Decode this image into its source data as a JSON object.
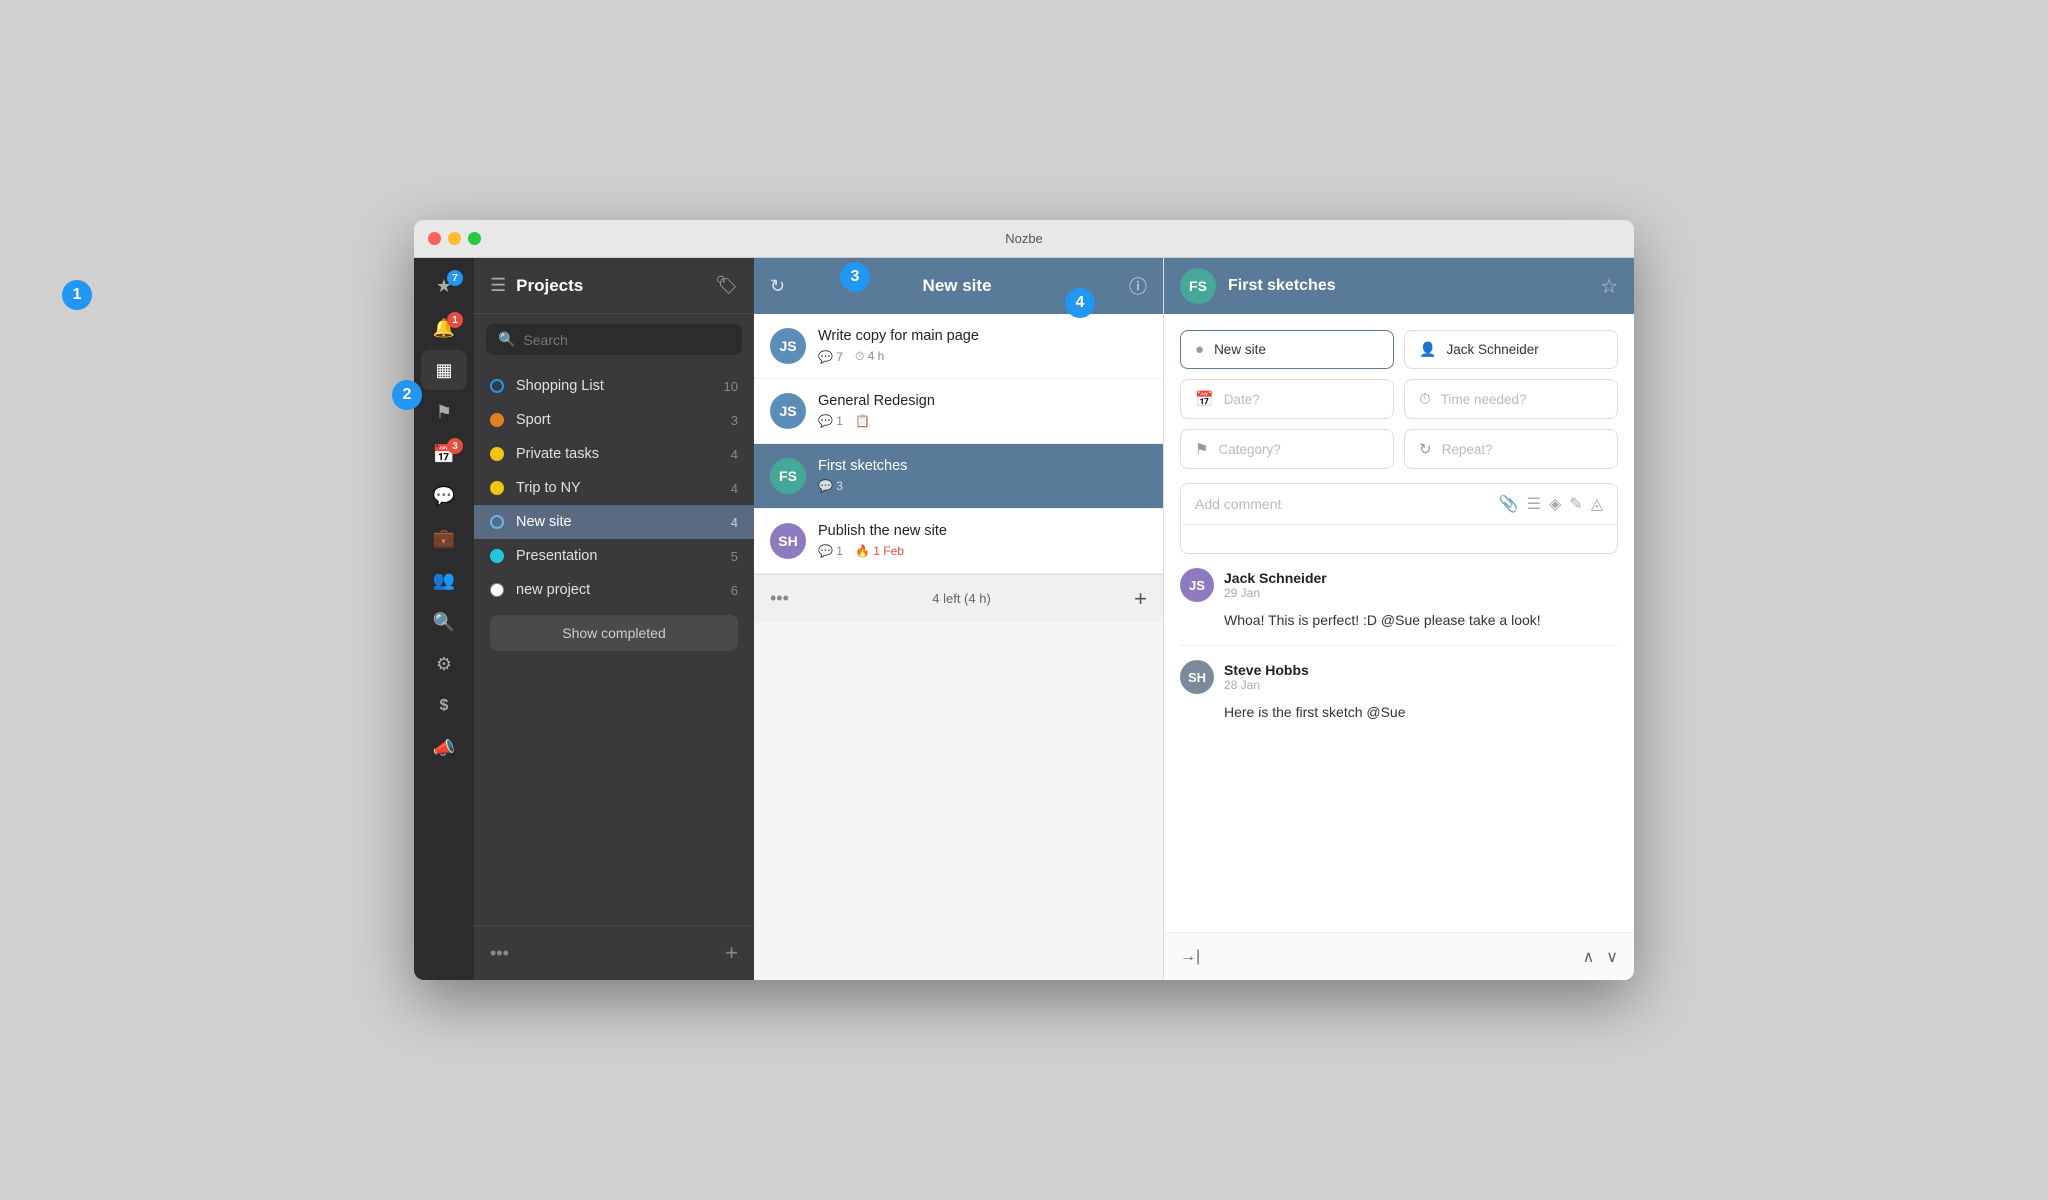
{
  "app": {
    "title": "Nozbe"
  },
  "icon_sidebar": {
    "items": [
      {
        "name": "star-icon",
        "icon": "★",
        "badge": "7",
        "has_badge": true,
        "badge_color": "blue"
      },
      {
        "name": "notification-icon",
        "icon": "🔔",
        "badge": "1",
        "has_badge": true,
        "badge_color": "red"
      },
      {
        "name": "projects-icon",
        "icon": "▦",
        "active": true
      },
      {
        "name": "flag-icon",
        "icon": "⚑"
      },
      {
        "name": "calendar-icon",
        "icon": "📅",
        "badge": "3",
        "has_badge": true,
        "badge_color": "red"
      },
      {
        "name": "chat-icon",
        "icon": "💬"
      },
      {
        "name": "briefcase-icon",
        "icon": "💼"
      },
      {
        "name": "team-icon",
        "icon": "👥"
      },
      {
        "name": "search-icon",
        "icon": "🔍"
      },
      {
        "name": "settings-icon",
        "icon": "⚙"
      },
      {
        "name": "dollar-icon",
        "icon": "$"
      },
      {
        "name": "megaphone-icon",
        "icon": "📣"
      }
    ]
  },
  "projects_panel": {
    "title": "Projects",
    "search_placeholder": "Search",
    "projects": [
      {
        "name": "Shopping List",
        "count": 10,
        "dot_type": "blue-outline"
      },
      {
        "name": "Sport",
        "count": 3,
        "dot_type": "orange"
      },
      {
        "name": "Private tasks",
        "count": 4,
        "dot_type": "yellow"
      },
      {
        "name": "Trip to NY",
        "count": 4,
        "dot_type": "yellow"
      },
      {
        "name": "New site",
        "count": 4,
        "dot_type": "active-blue",
        "active": true
      },
      {
        "name": "Presentation",
        "count": 5,
        "dot_type": "teal"
      },
      {
        "name": "new project",
        "count": 6,
        "dot_type": "white"
      }
    ],
    "show_completed_label": "Show completed",
    "footer_dots": "•••",
    "footer_plus": "+"
  },
  "tasks_panel": {
    "header_title": "New site",
    "tasks": [
      {
        "title": "Write copy for main page",
        "avatar_initials": "JS",
        "avatar_color": "blue",
        "meta": [
          {
            "icon": "💬",
            "value": "7"
          },
          {
            "icon": "⏱",
            "value": "4 h"
          }
        ]
      },
      {
        "title": "General Redesign",
        "avatar_initials": "JS",
        "avatar_color": "blue",
        "meta": [
          {
            "icon": "💬",
            "value": "1"
          },
          {
            "icon": "📋",
            "value": ""
          }
        ]
      },
      {
        "title": "First sketches",
        "avatar_initials": "FS",
        "avatar_color": "teal",
        "active": true,
        "meta": [
          {
            "icon": "💬",
            "value": "3"
          }
        ]
      },
      {
        "title": "Publish the new site",
        "avatar_initials": "SH",
        "avatar_color": "purple",
        "meta": [
          {
            "icon": "💬",
            "value": "1"
          },
          {
            "icon": "🔥",
            "value": "1 Feb",
            "red": true
          }
        ]
      }
    ],
    "footer_dots": "•••",
    "footer_status": "4 left (4 h)",
    "footer_plus": "+"
  },
  "detail_panel": {
    "task_name": "First sketches",
    "fields": {
      "project": "New site",
      "assignee": "Jack Schneider",
      "date_placeholder": "Date?",
      "time_placeholder": "Time needed?",
      "category_placeholder": "Category?",
      "repeat_placeholder": "Repeat?"
    },
    "comment_placeholder": "Add comment",
    "comments": [
      {
        "author": "Jack Schneider",
        "date": "29 Jan",
        "text": "Whoa! This is perfect! :D @Sue please take a look!",
        "avatar_initials": "JS",
        "avatar_color": "purple"
      },
      {
        "author": "Steve Hobbs",
        "date": "28 Jan",
        "text": "Here is the first sketch @Sue",
        "avatar_initials": "SH",
        "avatar_color": "grey"
      }
    ],
    "footer_arrow": "→|",
    "footer_up": "∧",
    "footer_down": "∨"
  },
  "tutorial_badges": [
    "1",
    "2",
    "3",
    "4"
  ]
}
